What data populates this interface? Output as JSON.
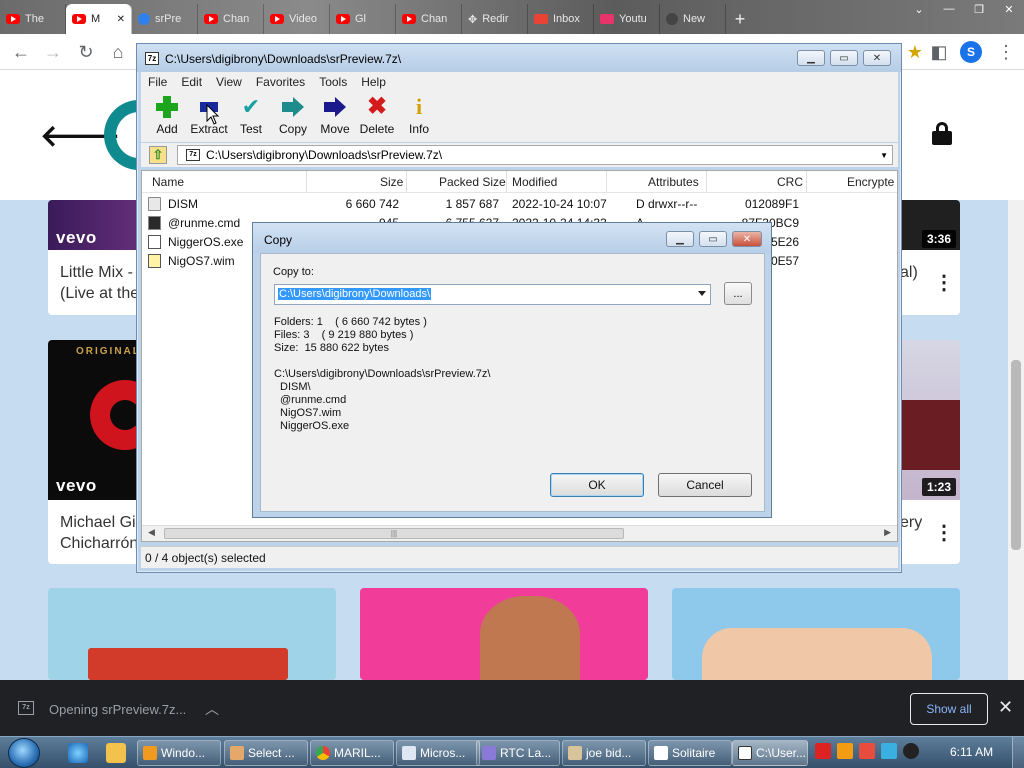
{
  "browser": {
    "tabs": [
      {
        "label": "The",
        "icon": "youtube-icon"
      },
      {
        "label": "M",
        "icon": "youtube-icon",
        "active": true
      },
      {
        "label": "srPre",
        "icon": "site-icon"
      },
      {
        "label": "Chan",
        "icon": "youtube-icon"
      },
      {
        "label": "Video",
        "icon": "youtube-icon"
      },
      {
        "label": "Gl",
        "icon": "youtube-icon"
      },
      {
        "label": "Chan",
        "icon": "youtube-icon"
      },
      {
        "label": "Redir",
        "icon": "move-icon"
      },
      {
        "label": "Inbox",
        "icon": "gmail-icon"
      },
      {
        "label": "Youtu",
        "icon": "download-icon"
      },
      {
        "label": "New",
        "icon": "github-icon"
      }
    ],
    "new_tab": "+",
    "window_controls": [
      "⌄",
      "—",
      "❐",
      "✕"
    ],
    "profile_initial": "S"
  },
  "youtube": {
    "videos": [
      {
        "title": "Little Mix -\n(Live at the",
        "badge": "vevo"
      },
      {
        "title": "Michael Gi\nChicharrón",
        "badge": "vevo",
        "tag": "ORIGINAL"
      },
      {
        "title": "al)",
        "duration": "3:36"
      },
      {
        "title": "ery",
        "duration": "1:23"
      }
    ]
  },
  "zip": {
    "title": "C:\\Users\\digibrony\\Downloads\\srPreview.7z\\",
    "icon_label": "7z",
    "menu": [
      "File",
      "Edit",
      "View",
      "Favorites",
      "Tools",
      "Help"
    ],
    "toolbar": {
      "add": "Add",
      "extract": "Extract",
      "test": "Test",
      "copy": "Copy",
      "move": "Move",
      "delete": "Delete",
      "info": "Info"
    },
    "address": "C:\\Users\\digibrony\\Downloads\\srPreview.7z\\",
    "columns": [
      "Name",
      "Size",
      "Packed Size",
      "Modified",
      "Attributes",
      "CRC",
      "Encrypte"
    ],
    "rows": [
      {
        "name": "DISM",
        "size": "6 660 742",
        "packed": "1 857 687",
        "modified": "2022-10-24 10:07",
        "attributes": "D drwxr--r--",
        "crc": "012089F1",
        "type": "folder"
      },
      {
        "name": "@runme.cmd",
        "size": "945",
        "packed": "6 755 627",
        "modified": "2022-10-24 14:33",
        "attributes": "A",
        "crc": "87F30BC9",
        "type": "cmd"
      },
      {
        "name": "NiggerOS.exe",
        "size": "",
        "packed": "",
        "modified": "",
        "attributes": "",
        "crc": "05E26",
        "type": "exe"
      },
      {
        "name": "NigOS7.wim",
        "size": "",
        "packed": "",
        "modified": "",
        "attributes": "",
        "crc": "90E57",
        "type": "wim"
      }
    ],
    "status": "0 / 4 object(s) selected"
  },
  "copy_dialog": {
    "title": "Copy",
    "copy_to_label": "Copy to:",
    "copy_to_value": "C:\\Users\\digibrony\\Downloads\\",
    "browse": "...",
    "folders": "Folders: 1    ( 6 660 742 bytes )",
    "files": "Files: 3    ( 9 219 880 bytes )",
    "size": "Size:  15 880 622 bytes",
    "source_path": "C:\\Users\\digibrony\\Downloads\\srPreview.7z\\",
    "items": [
      "DISM\\",
      "@runme.cmd",
      "NigOS7.wim",
      "NiggerOS.exe"
    ],
    "ok": "OK",
    "cancel": "Cancel"
  },
  "download_bar": {
    "item": "Opening srPreview.7z...",
    "show_all": "Show all"
  },
  "taskbar": {
    "buttons": [
      {
        "label": "Windo...",
        "icon": "media-player-icon"
      },
      {
        "label": "Select ...",
        "icon": "paint-icon"
      },
      {
        "label": "MARIL...",
        "icon": "chrome-icon"
      },
      {
        "label": "Micros...",
        "icon": "window-icon"
      },
      {
        "label": "RTC La...",
        "icon": "rtc-icon"
      },
      {
        "label": "joe bid...",
        "icon": "paw-icon"
      },
      {
        "label": "Solitaire",
        "icon": "solitaire-icon"
      },
      {
        "label": "C:\\User...",
        "icon": "7zip-icon",
        "active": true
      }
    ],
    "clock": "6:11 AM"
  },
  "colors": {
    "titlebar": "#bcd3ea",
    "selection": "#3399ff",
    "youtube_red": "#ff0000",
    "taskbar": "#35506b"
  }
}
